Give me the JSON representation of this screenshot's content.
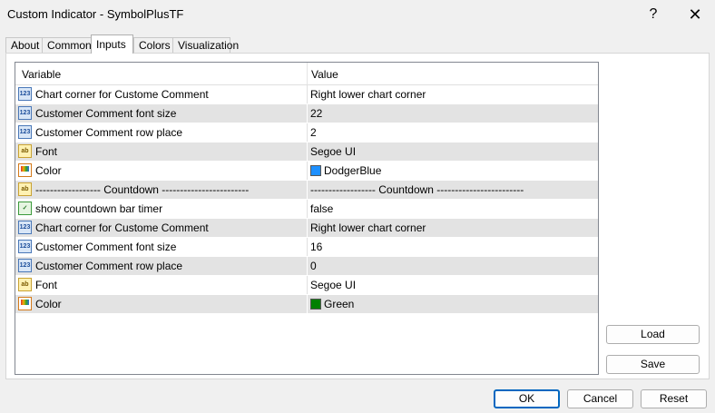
{
  "window": {
    "title": "Custom Indicator - SymbolPlusTF",
    "help_glyph": "?",
    "close_glyph": "✕"
  },
  "tabs": [
    {
      "label": "About"
    },
    {
      "label": "Common"
    },
    {
      "label": "Inputs",
      "active": true
    },
    {
      "label": "Colors"
    },
    {
      "label": "Visualization"
    }
  ],
  "grid": {
    "header": {
      "variable": "Variable",
      "value": "Value"
    },
    "rows": [
      {
        "icon": "number-icon",
        "variable": "Chart corner for Custome Comment",
        "value": "Right lower chart corner"
      },
      {
        "icon": "number-icon",
        "variable": "Customer Comment font size",
        "value": "22"
      },
      {
        "icon": "number-icon",
        "variable": "Customer Comment row place",
        "value": "2"
      },
      {
        "icon": "text-icon",
        "variable": "Font",
        "value": "Segoe UI"
      },
      {
        "icon": "color-icon",
        "variable": "Color",
        "value": "DodgerBlue",
        "swatch": "#1e90ff"
      },
      {
        "icon": "text-icon",
        "variable": "------------------  Countdown  ------------------------",
        "value": "------------------  Countdown  ------------------------"
      },
      {
        "icon": "bool-icon",
        "variable": "show countdown bar timer",
        "value": "false"
      },
      {
        "icon": "number-icon",
        "variable": "Chart corner for Custome Comment",
        "value": "Right lower chart corner"
      },
      {
        "icon": "number-icon",
        "variable": "Customer Comment font size",
        "value": "16"
      },
      {
        "icon": "number-icon",
        "variable": "Customer Comment row place",
        "value": "0"
      },
      {
        "icon": "text-icon",
        "variable": "Font",
        "value": "Segoe UI"
      },
      {
        "icon": "color-icon",
        "variable": "Color",
        "value": "Green",
        "swatch": "#008000"
      }
    ]
  },
  "side_buttons": {
    "load": "Load",
    "save": "Save"
  },
  "footer_buttons": {
    "ok": "OK",
    "cancel": "Cancel",
    "reset": "Reset"
  }
}
